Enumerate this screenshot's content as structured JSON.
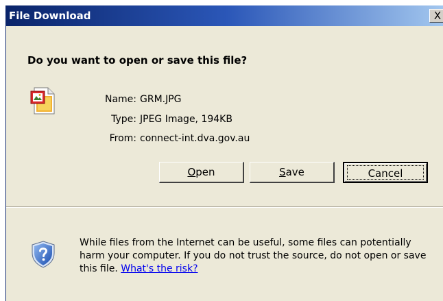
{
  "window": {
    "title": "File Download",
    "close_glyph": "X"
  },
  "dialog": {
    "question": "Do you want to open or save this file?",
    "file_icon": "jpeg-image-file-icon",
    "fields": {
      "name_label": "Name:",
      "name_value": "GRM.JPG",
      "type_label": "Type:",
      "type_value": "JPEG Image, 194KB",
      "from_label": "From:",
      "from_value": "connect-int.dva.gov.au"
    },
    "buttons": {
      "open_mnemonic": "O",
      "open_rest": "pen",
      "save_mnemonic": "S",
      "save_rest": "ave",
      "cancel_label": "Cancel"
    }
  },
  "warning": {
    "icon": "security-shield-question-icon",
    "text": "While files from the Internet can be useful, some files can potentially harm your computer. If you do not trust the source, do not open or save this file.",
    "link_text": "What's the risk?"
  },
  "colors": {
    "title_bar_start": "#0a246a",
    "title_bar_end": "#a6caf0",
    "dialog_background": "#ece9d8",
    "link": "#0000ee"
  }
}
